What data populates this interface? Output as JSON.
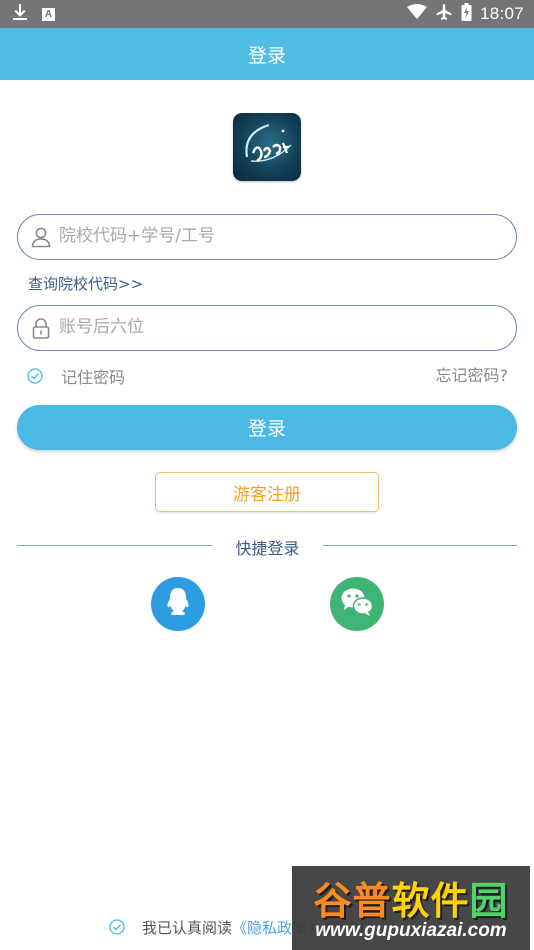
{
  "status_bar": {
    "time": "18:07",
    "left_icons": [
      "download-icon",
      "a-notification-icon"
    ],
    "right_icons": [
      "wifi-icon",
      "airplane-icon",
      "battery-icon"
    ],
    "a_glyph": "A"
  },
  "header": {
    "title": "登录"
  },
  "logo": {
    "icon": "app-logo-icon"
  },
  "form": {
    "account_placeholder": "院校代码+学号/工号",
    "query_link": "查询院校代码>>",
    "password_placeholder": "账号后六位",
    "remember_label": "记住密码",
    "remember_checked": true,
    "forgot_label": "忘记密码?",
    "login_button": "登录",
    "guest_button": "游客注册"
  },
  "quick_login": {
    "label": "快捷登录",
    "providers": [
      {
        "name": "qq",
        "icon": "qq-icon",
        "color": "#2b9de0"
      },
      {
        "name": "wechat",
        "icon": "wechat-icon",
        "color": "#3eb575"
      }
    ]
  },
  "agreement": {
    "prefix": "我已认真阅读",
    "link_visible": "《隐私政策》《用户协议》",
    "checked": true
  },
  "watermark": {
    "title_parts": [
      "谷普",
      "软件",
      "园"
    ],
    "url": "www.gupuxiazai.com"
  },
  "colors": {
    "accent": "#4fbde6",
    "status_bar": "#757575",
    "input_border": "#6e86b3",
    "guest_text": "#f1a126",
    "link": "#3d5a8a"
  }
}
